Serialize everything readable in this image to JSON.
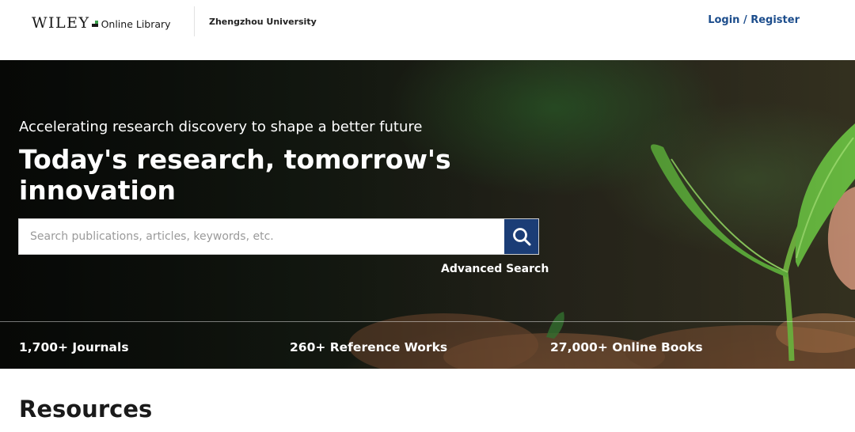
{
  "header": {
    "logo_wordmark": "WILEY",
    "logo_suffix": "Online Library",
    "institution": "Zhengzhou University",
    "login_label": "Login / Register"
  },
  "hero": {
    "subtitle": "Accelerating research discovery to shape a better future",
    "title": "Today's research, tomorrow's innovation",
    "search": {
      "placeholder": "Search publications, articles, keywords, etc.",
      "value": "",
      "button_icon": "search-icon"
    },
    "advanced_search_label": "Advanced Search",
    "stats": [
      {
        "label": "1,700+ Journals"
      },
      {
        "label": "260+ Reference Works"
      },
      {
        "label": "27,000+ Online Books"
      }
    ]
  },
  "resources_heading": "Resources",
  "colors": {
    "link_blue": "#1c4d8c",
    "search_button": "#1b3d76",
    "logo_green": "#3aa04a"
  }
}
